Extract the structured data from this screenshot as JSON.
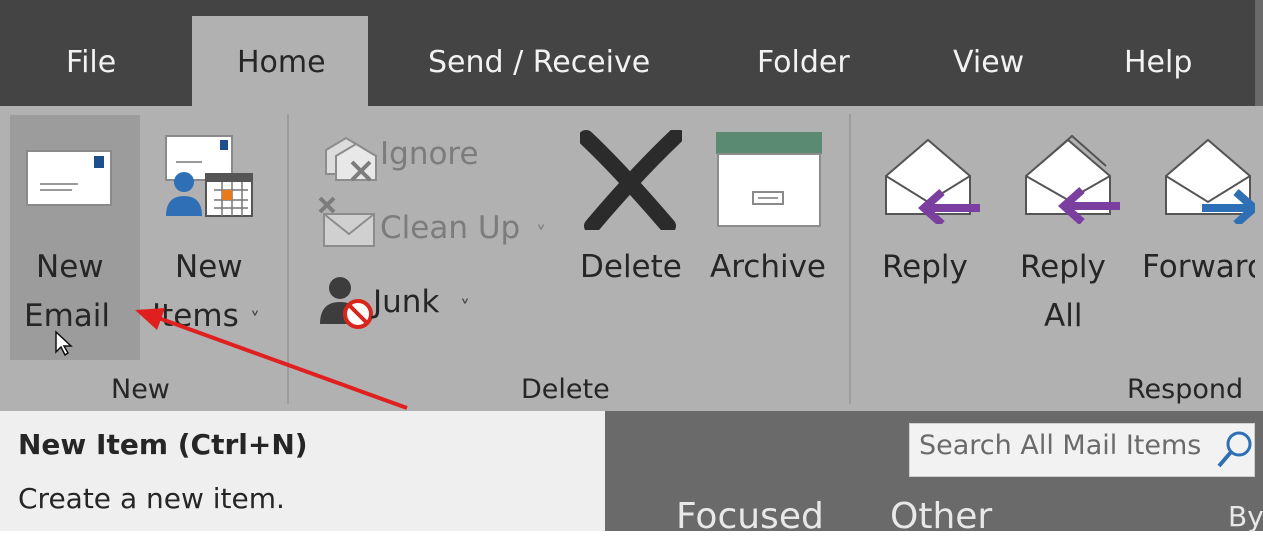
{
  "tabs": [
    {
      "label": "File"
    },
    {
      "label": "Home"
    },
    {
      "label": "Send / Receive"
    },
    {
      "label": "Folder"
    },
    {
      "label": "View"
    },
    {
      "label": "Help"
    }
  ],
  "active_tab": "Home",
  "ribbon": {
    "new_group": {
      "label": "New",
      "new_email": {
        "line1": "New",
        "line2": "Email"
      },
      "new_items": {
        "line1": "New",
        "line2": "Items",
        "dropdown": "˅"
      }
    },
    "delete_group": {
      "label": "Delete",
      "ignore": "Ignore",
      "clean_up": "Clean Up",
      "junk": "Junk",
      "delete": "Delete",
      "archive": "Archive"
    },
    "respond_group": {
      "label": "Respond",
      "reply": "Reply",
      "reply_all": {
        "line1": "Reply",
        "line2": "All"
      },
      "forward": "Forward"
    }
  },
  "tooltip": {
    "title": "New Item (Ctrl+N)",
    "description": "Create a new item."
  },
  "mail_list": {
    "search_placeholder": "Search All Mail Items",
    "tabs": [
      "Focused",
      "Other"
    ],
    "sort_label": "By"
  },
  "colors": {
    "tab_bar": "#444444",
    "ribbon": "#b1b1b1",
    "highlight": "#9c9c9c",
    "reply_arrow": "#7b3fa0",
    "forward_arrow": "#2e6fb5",
    "archive_green": "#5a8a72",
    "annotation_arrow": "#e0201e"
  },
  "icons": [
    "envelope-icon",
    "new-items-icon",
    "ignore-icon",
    "clean-up-icon",
    "junk-icon",
    "delete-icon",
    "archive-icon",
    "reply-icon",
    "reply-all-icon",
    "forward-icon",
    "search-icon",
    "cursor-icon"
  ]
}
